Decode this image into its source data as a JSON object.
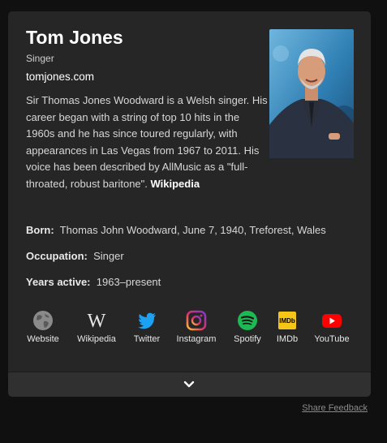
{
  "entity": {
    "title": "Tom Jones",
    "subtitle": "Singer",
    "website": "tomjones.com",
    "description": "Sir Thomas Jones Woodward is a Welsh singer. His career began with a string of top 10 hits in the 1960s and he has since toured regularly, with appearances in Las Vegas from 1967 to 2011. His voice has been described by AllMusic as a \"full-throated, robust baritone\".",
    "description_source": "Wikipedia"
  },
  "facts": [
    {
      "label": "Born:",
      "value": "Thomas John Woodward, June 7, 1940, Treforest, Wales"
    },
    {
      "label": "Occupation:",
      "value": "Singer"
    },
    {
      "label": "Years active:",
      "value": "1963–present"
    }
  ],
  "socials": [
    {
      "label": "Website",
      "icon": "globe-icon"
    },
    {
      "label": "Wikipedia",
      "icon": "wikipedia-icon"
    },
    {
      "label": "Twitter",
      "icon": "twitter-icon"
    },
    {
      "label": "Instagram",
      "icon": "instagram-icon"
    },
    {
      "label": "Spotify",
      "icon": "spotify-icon"
    },
    {
      "label": "IMDb",
      "icon": "imdb-icon",
      "icon_text": "IMDb"
    },
    {
      "label": "YouTube",
      "icon": "youtube-icon"
    }
  ],
  "footer": {
    "feedback": "Share Feedback"
  },
  "colors": {
    "background": "#101010",
    "card": "#262626",
    "twitter": "#1da1f2",
    "spotify": "#1db954",
    "imdb": "#f5c518",
    "youtube": "#ff0000"
  }
}
